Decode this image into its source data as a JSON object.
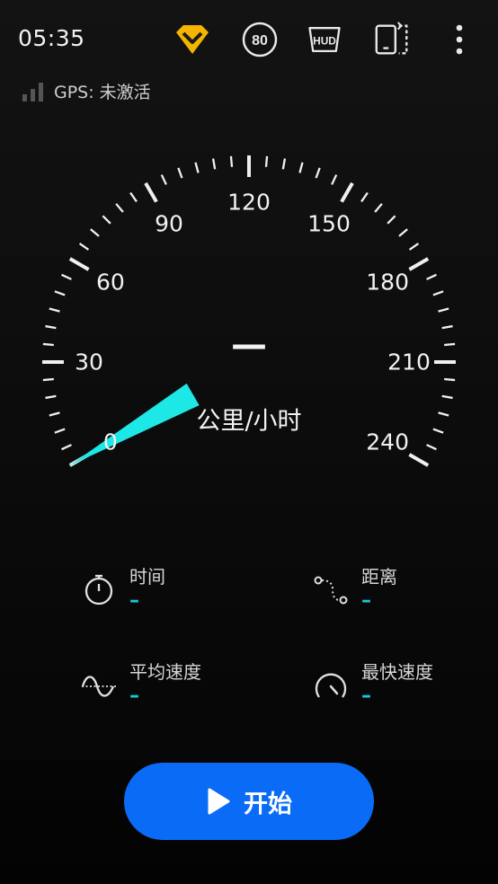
{
  "status_bar": {
    "time": "05:35",
    "icons": [
      "premium-diamond-icon",
      "speed-limit-icon",
      "hud-icon",
      "device-rotate-icon",
      "more-vert-icon"
    ],
    "speed_limit_label": "80",
    "hud_label": "HUD",
    "accent_diamond": "#f4b400"
  },
  "gps": {
    "label": "GPS: 未激活",
    "signal_icon": "signal-bars-icon"
  },
  "speedometer": {
    "current_speed": "—",
    "unit": "公里/小时",
    "scale_min": 0,
    "scale_max": 240,
    "major_ticks": [
      "0",
      "30",
      "60",
      "90",
      "120",
      "150",
      "180",
      "210",
      "240"
    ],
    "needle_value": 0,
    "needle_color": "#1de8e6"
  },
  "stats": {
    "time": {
      "label": "时间",
      "value": "–",
      "icon": "stopwatch-icon"
    },
    "distance": {
      "label": "距离",
      "value": "–",
      "icon": "route-icon"
    },
    "avg_speed": {
      "label": "平均速度",
      "value": "–",
      "icon": "wave-icon"
    },
    "max_speed": {
      "label": "最快速度",
      "value": "–",
      "icon": "gauge-icon"
    }
  },
  "start_button": {
    "label": "开始",
    "icon": "play-icon",
    "color": "#0a6cf6"
  }
}
